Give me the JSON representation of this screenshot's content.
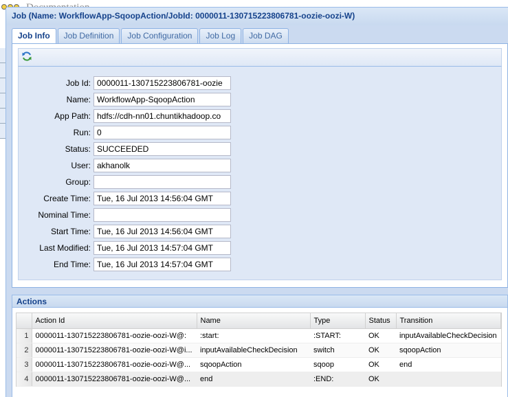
{
  "background": {
    "title": "Documentation"
  },
  "window": {
    "title": "Job (Name: WorkflowApp-SqoopAction/JobId: 0000011-130715223806781-oozie-oozi-W)"
  },
  "tabs": [
    {
      "label": "Job Info",
      "active": true
    },
    {
      "label": "Job Definition",
      "active": false
    },
    {
      "label": "Job Configuration",
      "active": false
    },
    {
      "label": "Job Log",
      "active": false
    },
    {
      "label": "Job DAG",
      "active": false
    }
  ],
  "form": {
    "job_id": {
      "label": "Job Id:",
      "value": "0000011-130715223806781-oozie"
    },
    "name": {
      "label": "Name:",
      "value": "WorkflowApp-SqoopAction"
    },
    "app_path": {
      "label": "App Path:",
      "value": "hdfs://cdh-nn01.chuntikhadoop.co"
    },
    "run": {
      "label": "Run:",
      "value": "0"
    },
    "status": {
      "label": "Status:",
      "value": "SUCCEEDED"
    },
    "user": {
      "label": "User:",
      "value": "akhanolk"
    },
    "group": {
      "label": "Group:",
      "value": ""
    },
    "create_time": {
      "label": "Create Time:",
      "value": "Tue, 16 Jul 2013 14:56:04 GMT"
    },
    "nominal_time": {
      "label": "Nominal Time:",
      "value": ""
    },
    "start_time": {
      "label": "Start Time:",
      "value": "Tue, 16 Jul 2013 14:56:04 GMT"
    },
    "last_modified": {
      "label": "Last Modified:",
      "value": "Tue, 16 Jul 2013 14:57:04 GMT"
    },
    "end_time": {
      "label": "End Time:",
      "value": "Tue, 16 Jul 2013 14:57:04 GMT"
    }
  },
  "actions": {
    "title": "Actions",
    "columns": [
      "Action Id",
      "Name",
      "Type",
      "Status",
      "Transition"
    ],
    "rows": [
      {
        "n": "1",
        "id": "0000011-130715223806781-oozie-oozi-W@:",
        "name": ":start:",
        "type": ":START:",
        "status": "OK",
        "transition": "inputAvailableCheckDecision"
      },
      {
        "n": "2",
        "id": "0000011-130715223806781-oozie-oozi-W@i...",
        "name": "inputAvailableCheckDecision",
        "type": "switch",
        "status": "OK",
        "transition": "sqoopAction"
      },
      {
        "n": "3",
        "id": "0000011-130715223806781-oozie-oozi-W@...",
        "name": "sqoopAction",
        "type": "sqoop",
        "status": "OK",
        "transition": "end"
      },
      {
        "n": "4",
        "id": "0000011-130715223806781-oozie-oozi-W@...",
        "name": "end",
        "type": ":END:",
        "status": "OK",
        "transition": ""
      }
    ]
  },
  "icons": {
    "refresh": "refresh-icon"
  }
}
